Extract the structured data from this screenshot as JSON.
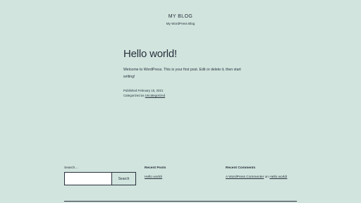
{
  "site": {
    "title": "MY BLOG",
    "tagline": "My WordPress Blog"
  },
  "post": {
    "title": "Hello world!",
    "content": "Welcome to WordPress. This is your first post. Edit or delete it, then start writing!",
    "published": "Published February 15, 2021",
    "categorized_prefix": "Categorized as ",
    "category": "Uncategorized"
  },
  "search": {
    "label": "Search…",
    "value": "",
    "button_label": "Search"
  },
  "recent_posts": {
    "heading": "Recent Posts",
    "items": [
      "Hello world!"
    ]
  },
  "recent_comments": {
    "heading": "Recent Comments",
    "author": "A WordPress Commenter",
    "on_text": " on ",
    "post": "Hello world!"
  }
}
